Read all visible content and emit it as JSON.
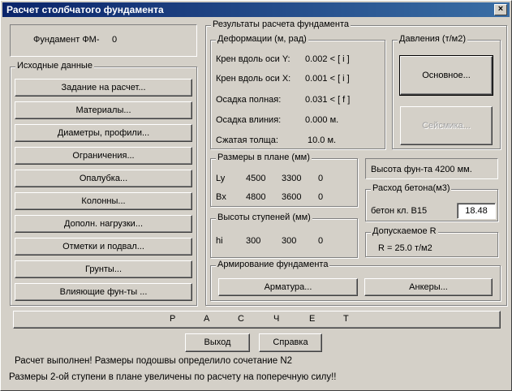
{
  "window": {
    "title": "Расчет столбчатого фундамента",
    "close_glyph": "×"
  },
  "foundation_label": "Фундамент ФМ-",
  "foundation_number": "0",
  "input": {
    "legend": "Исходные данные",
    "buttons": [
      "Задание на расчет...",
      "Материалы...",
      "Диаметры, профили...",
      "Ограничения...",
      "Опалубка...",
      "Колонны...",
      "Дополн. нагрузки...",
      "Отметки и подвал...",
      "Грунты...",
      "Влияющие фун-ты ..."
    ]
  },
  "results": {
    "legend": "Результаты расчета фундамента",
    "deform": {
      "legend": "Деформации  (м, рад)",
      "rows": [
        {
          "label": "Крен вдоль оси Y:",
          "value": "0.002 < [ i ]"
        },
        {
          "label": "Крен вдоль оси X:",
          "value": "0.001 < [ i ]"
        },
        {
          "label": "Осадка полная:",
          "value": "0.031 < [ f ]"
        },
        {
          "label": "Осадка влиния:",
          "value": "0.000 м."
        },
        {
          "label": "Сжатая толща:",
          "value": "10.0 м."
        }
      ]
    },
    "pressure": {
      "legend": "Давления (т/м2)",
      "main_button": "Основное...",
      "seismic_button": "Сейсмика..."
    },
    "plan_sizes": {
      "legend": "Размеры в плане (мм)",
      "rows": [
        {
          "label": "Ly",
          "v1": "4500",
          "v2": "3300",
          "v3": "0"
        },
        {
          "label": "Bx",
          "v1": "4800",
          "v2": "3600",
          "v3": "0"
        }
      ]
    },
    "step_heights": {
      "legend": "Высоты ступеней (мм)",
      "row": {
        "label": "hi",
        "v1": "300",
        "v2": "300",
        "v3": "0"
      }
    },
    "height_text": "Высота фун-та  4200 мм.",
    "concrete": {
      "legend": "Расход бетона(м3)",
      "label": "бетон кл. В15",
      "value": "18.48"
    },
    "allowable": {
      "legend": "Допускаемое  R",
      "value": "R =  25.0 т/м2"
    },
    "reinforcement": {
      "legend": "Армирование фундамента",
      "rebar_button": "Арматура...",
      "anchors_button": "Анкеры..."
    }
  },
  "calc_button_letters": [
    "Р",
    "А",
    "С",
    "Ч",
    "Е",
    "Т"
  ],
  "exit_button": "Выход",
  "help_button": "Справка",
  "status1": "Расчет выполнен! Размеры подошвы определило сочетание  N2",
  "status2": "Размеры 2-ой ступени в плане увеличены по расчету на поперечную силу!!"
}
